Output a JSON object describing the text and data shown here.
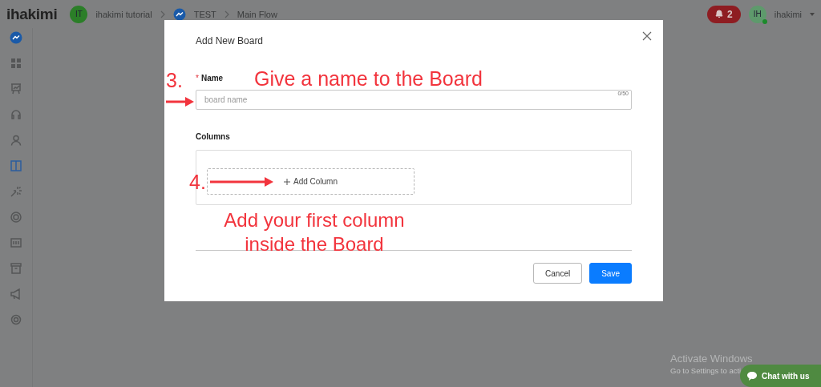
{
  "header": {
    "logo": "ihakimi",
    "workspace": {
      "initials": "IT",
      "name": "ihakimi tutorial"
    },
    "breadcrumbs": [
      "TEST",
      "Main Flow"
    ],
    "notifications": "2",
    "user": {
      "initials": "IH",
      "name": "ihakimi",
      "online": true
    }
  },
  "sidebar": {
    "items": [
      {
        "selected": false
      },
      {
        "selected": false
      },
      {
        "selected": false
      },
      {
        "selected": false
      },
      {
        "selected": true
      },
      {
        "selected": false
      },
      {
        "selected": false
      },
      {
        "selected": false
      },
      {
        "selected": false
      },
      {
        "selected": false
      },
      {
        "selected": false
      }
    ]
  },
  "modal": {
    "title": "Add New Board",
    "name_field": {
      "required_mark": "*",
      "label": "Name",
      "placeholder": "board name",
      "counter": "0/50"
    },
    "columns": {
      "label": "Columns",
      "add_button": "Add Column"
    },
    "buttons": [
      {
        "label": "Cancel",
        "kind": "secondary"
      },
      {
        "label": "Save",
        "kind": "primary"
      }
    ]
  },
  "annotations": {
    "step_name": "3.",
    "name_hint": "Give a name to the Board",
    "step_column": "4.",
    "column_hint": "Add your first column inside the Board"
  },
  "system": {
    "activation_title": "Activate Windows",
    "activation_text": "Go to Settings to acti"
  },
  "chat": {
    "label": "Chat with us"
  }
}
